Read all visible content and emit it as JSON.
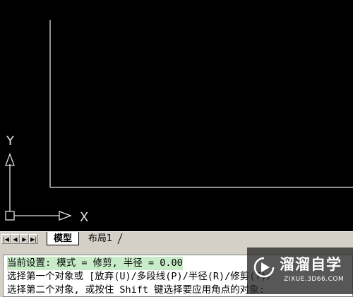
{
  "canvas": {
    "background": "#000000",
    "line_color": "#c0c0c0"
  },
  "ucs": {
    "x_label": "X",
    "y_label": "Y"
  },
  "tabs": {
    "nav_icons": [
      "first-tab-icon",
      "prev-tab-icon",
      "next-tab-icon",
      "last-tab-icon"
    ],
    "items": [
      {
        "label": "模型",
        "active": true
      },
      {
        "label": "布局1",
        "active": false
      }
    ]
  },
  "command": {
    "lines": [
      "当前设置: 模式 = 修剪, 半径 = 0.00",
      "选择第一个对象或 [放弃(U)/多段线(P)/半径(R)/修剪(T)/",
      "选择第二个对象, 或按住 Shift 键选择要应用角点的对象:"
    ]
  },
  "watermark": {
    "title": "溜溜自学",
    "url": "ZIXUE.3D66.COM"
  }
}
